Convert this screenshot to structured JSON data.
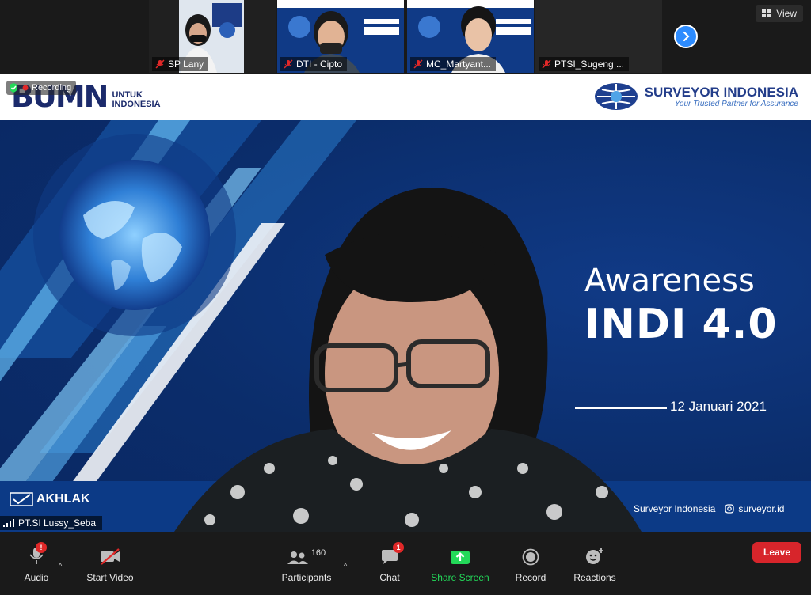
{
  "participants_strip": [
    {
      "name": "SP Lany",
      "muted": true
    },
    {
      "name": "DTI - Cipto",
      "muted": true
    },
    {
      "name": "MC_Martyant...",
      "muted": true
    },
    {
      "name": "PTSI_Sugeng ...",
      "muted": true
    }
  ],
  "view_button": {
    "label": "View",
    "icon": "grid-icon"
  },
  "next_page_icon": "chevron-right-icon",
  "recording": {
    "label": "Recording"
  },
  "slide": {
    "bumn_logo": "BUMN",
    "bumn_sub_line1": "UNTUK",
    "bumn_sub_line2": "INDONESIA",
    "company_name": "SURVEYOR INDONESIA",
    "company_tagline": "Your Trusted Partner for Assurance",
    "title_line1": "Awareness",
    "title_line2": "INDI 4.0",
    "date": "12 Januari 2021",
    "footer_left": "AKHLAK",
    "footer_right_1": "Surveyor Indonesia",
    "footer_right_2": "surveyor.id"
  },
  "active_speaker": {
    "name": "PT.SI Lussy_Seba"
  },
  "toolbar": {
    "audio": {
      "label": "Audio"
    },
    "video": {
      "label": "Start Video"
    },
    "participants": {
      "label": "Participants",
      "count": "160"
    },
    "chat": {
      "label": "Chat",
      "badge": "1"
    },
    "share": {
      "label": "Share Screen"
    },
    "record": {
      "label": "Record"
    },
    "reactions": {
      "label": "Reactions"
    },
    "leave": {
      "label": "Leave"
    }
  },
  "colors": {
    "share_green": "#23d959",
    "leave_red": "#d7252b",
    "accent_blue": "#2d8cff",
    "slide_blue": "#0b2d6b"
  }
}
